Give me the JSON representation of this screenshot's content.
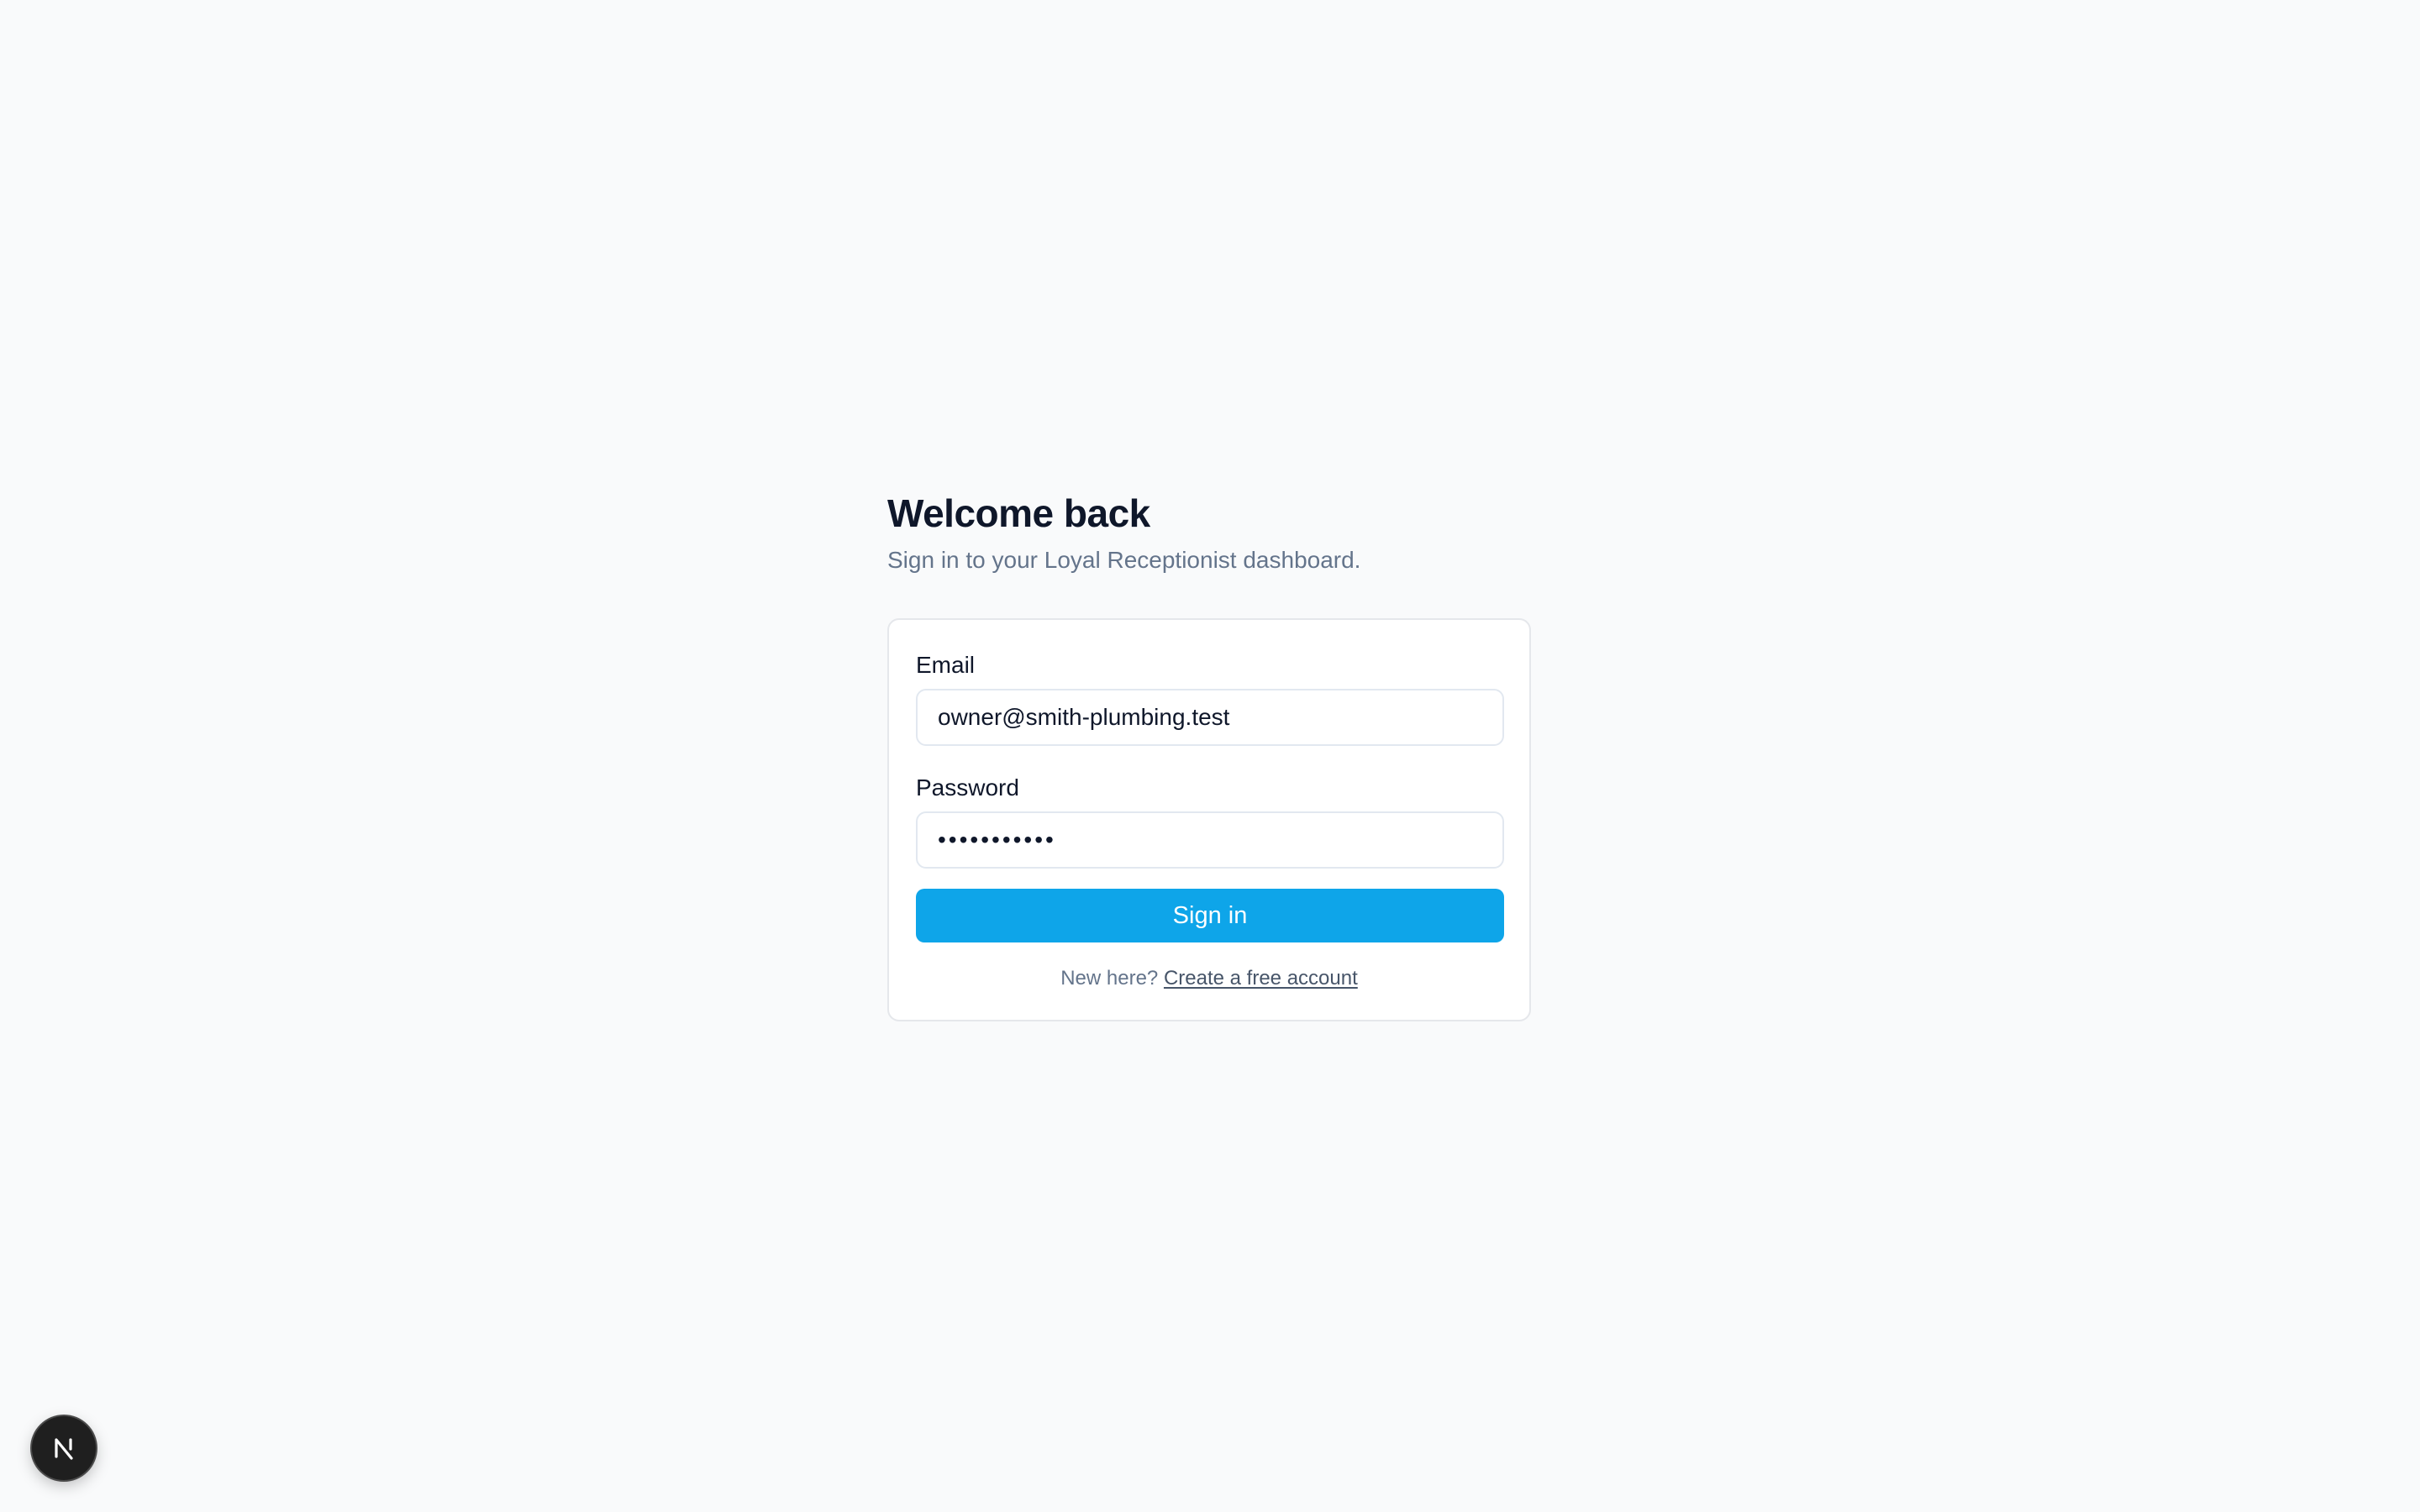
{
  "header": {
    "title": "Welcome back",
    "subtitle": "Sign in to your Loyal Receptionist dashboard."
  },
  "form": {
    "email_label": "Email",
    "email_value": "owner@smith-plumbing.test",
    "password_label": "Password",
    "password_value": "•••••••••••",
    "submit_label": "Sign in",
    "footer_text": "New here? ",
    "footer_link": "Create a free account"
  },
  "dev_badge": {
    "icon": "nextjs-logo-icon",
    "letter": "N"
  },
  "colors": {
    "background": "#f9fafb",
    "accent": "#0ea5e9",
    "title": "#0f172a",
    "muted": "#64748b",
    "border": "#e5e7eb"
  }
}
